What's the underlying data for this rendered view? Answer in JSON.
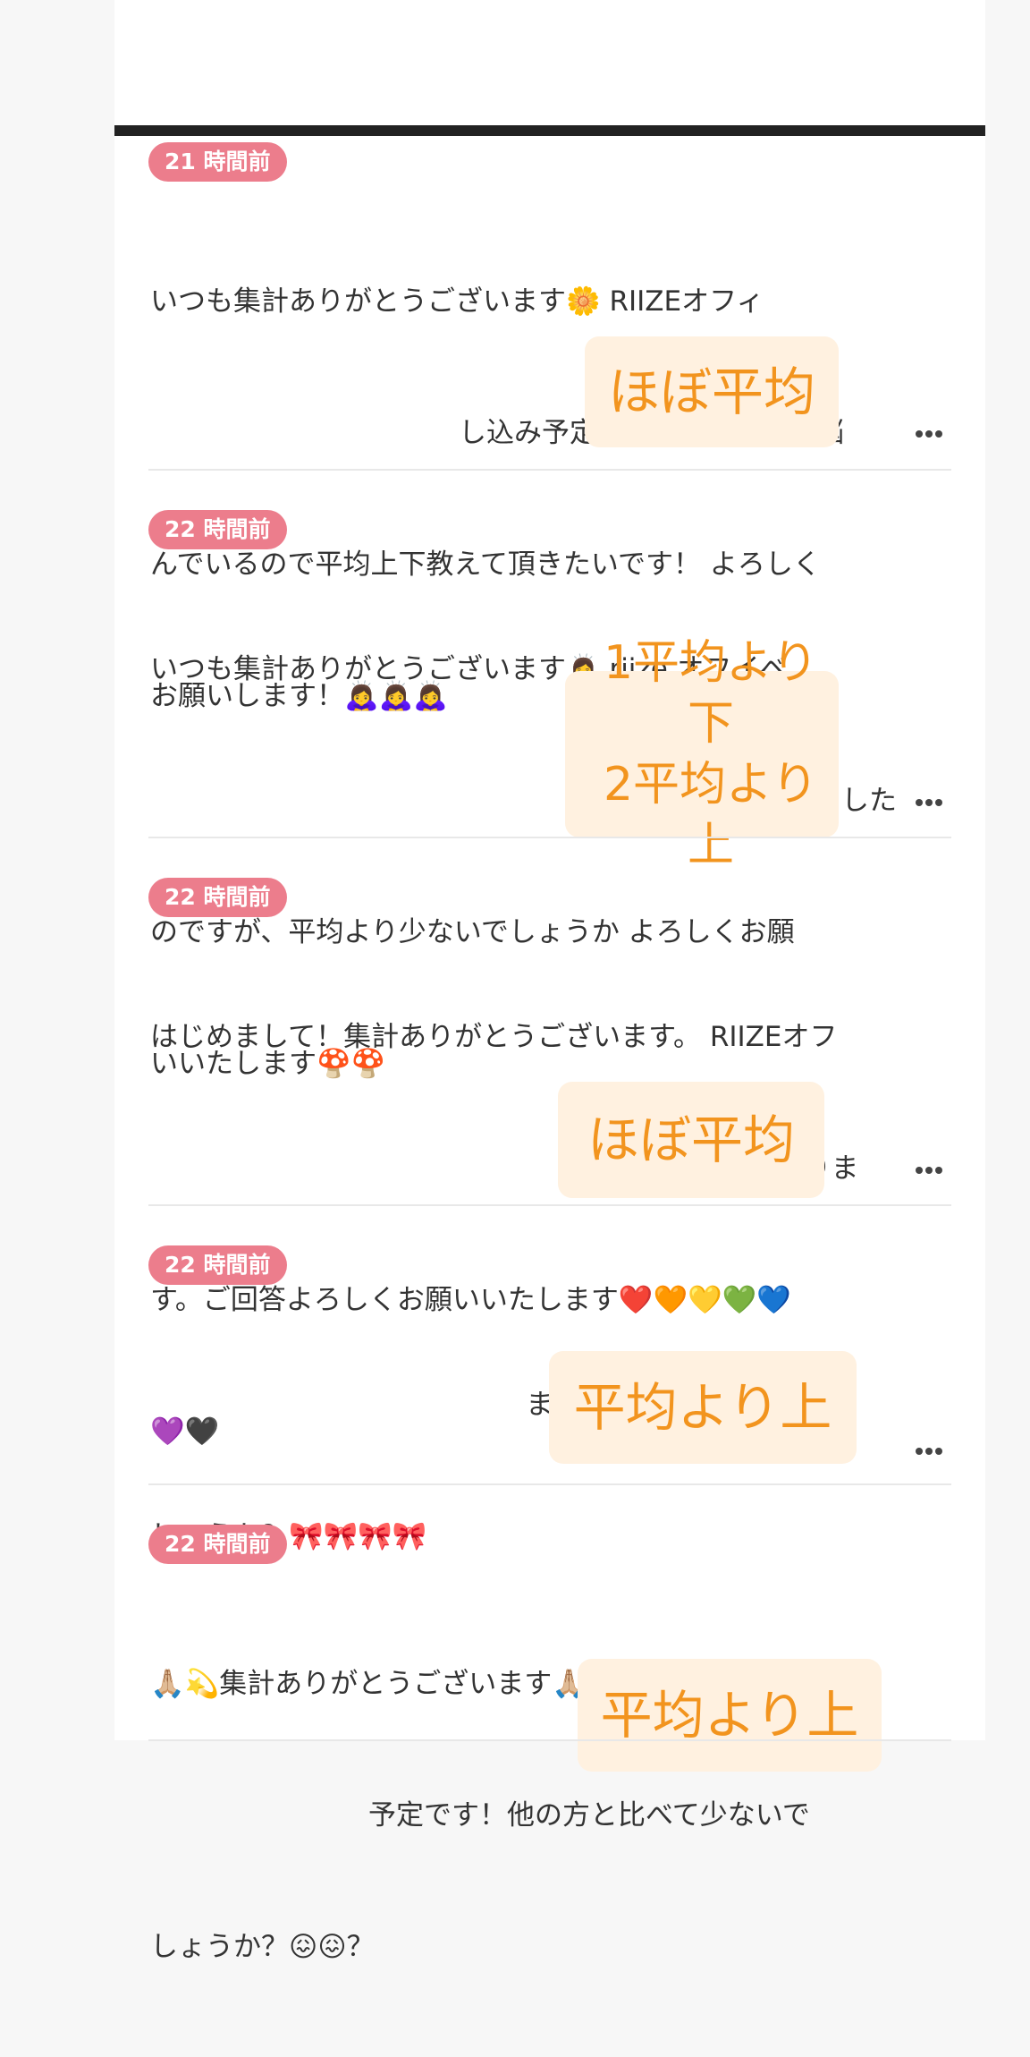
{
  "comments": [
    {
      "time": "21 時間前",
      "lines": [
        "いつも集計ありがとうございます🌼 RIIZEオフィ",
        "し込み予定です。追加するか悩",
        "んでいるので平均上下教えて頂きたいです！ よろしく",
        "お願いします！🙇‍♀️🙇‍♀️🙇‍♀️"
      ],
      "answer": "ほぼ平均"
    },
    {
      "time": "22 時間前",
      "lines": [
        "いつも集計ありがとうございます🙇‍♀️ riize オフイベ",
        "予定にした",
        "のですが、平均より少ないでしょうか よろしくお願",
        "いいたします🍄🍄"
      ],
      "answer_lines": [
        "1平均より下",
        "2平均より上"
      ]
    },
    {
      "time": "22 時間前",
      "lines": [
        "はじめまして！集計ありがとうございます。 RIIZEオフ",
        "えておりま",
        "す。ご回答よろしくお願いいたします❤️🧡💛💚💙",
        "💜🖤"
      ],
      "answer": "ほぼ平均"
    },
    {
      "time": "22 時間前",
      "lines": [
        "ます🎀🎀🎀🎀 いかがで",
        "しょうか？🎀🎀🎀🎀"
      ],
      "answer": "平均より上"
    },
    {
      "time": "22 時間前",
      "lines": [
        "🙏🏼💫集計ありがとうございます🙏🏼💫",
        "予定です！他の方と比べて少ないで",
        "しょうか？😖😖？"
      ],
      "answer": "平均より上"
    }
  ],
  "colors": {
    "badge": "#ec7d8c",
    "sticker_bg": "#fff1e0",
    "sticker_text": "#f2941e",
    "top_bar": "#222222"
  }
}
